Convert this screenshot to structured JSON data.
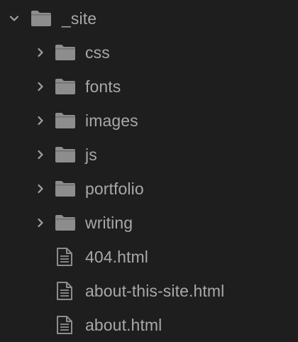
{
  "colors": {
    "background": "#1e1e1f",
    "text": "#a8a8a9",
    "icon": "#8d8d8e",
    "chevron": "#a2a2a3"
  },
  "tree": {
    "root": {
      "label": "_site",
      "icon": "folder-icon",
      "expanded": true
    },
    "folders": [
      {
        "label": "css",
        "icon": "folder-icon",
        "expanded": false
      },
      {
        "label": "fonts",
        "icon": "folder-icon",
        "expanded": false
      },
      {
        "label": "images",
        "icon": "folder-icon",
        "expanded": false
      },
      {
        "label": "js",
        "icon": "folder-icon",
        "expanded": false
      },
      {
        "label": "portfolio",
        "icon": "folder-icon",
        "expanded": false
      },
      {
        "label": "writing",
        "icon": "folder-icon",
        "expanded": false
      }
    ],
    "files": [
      {
        "label": "404.html",
        "icon": "file-icon"
      },
      {
        "label": "about-this-site.html",
        "icon": "file-icon"
      },
      {
        "label": "about.html",
        "icon": "file-icon"
      }
    ]
  }
}
